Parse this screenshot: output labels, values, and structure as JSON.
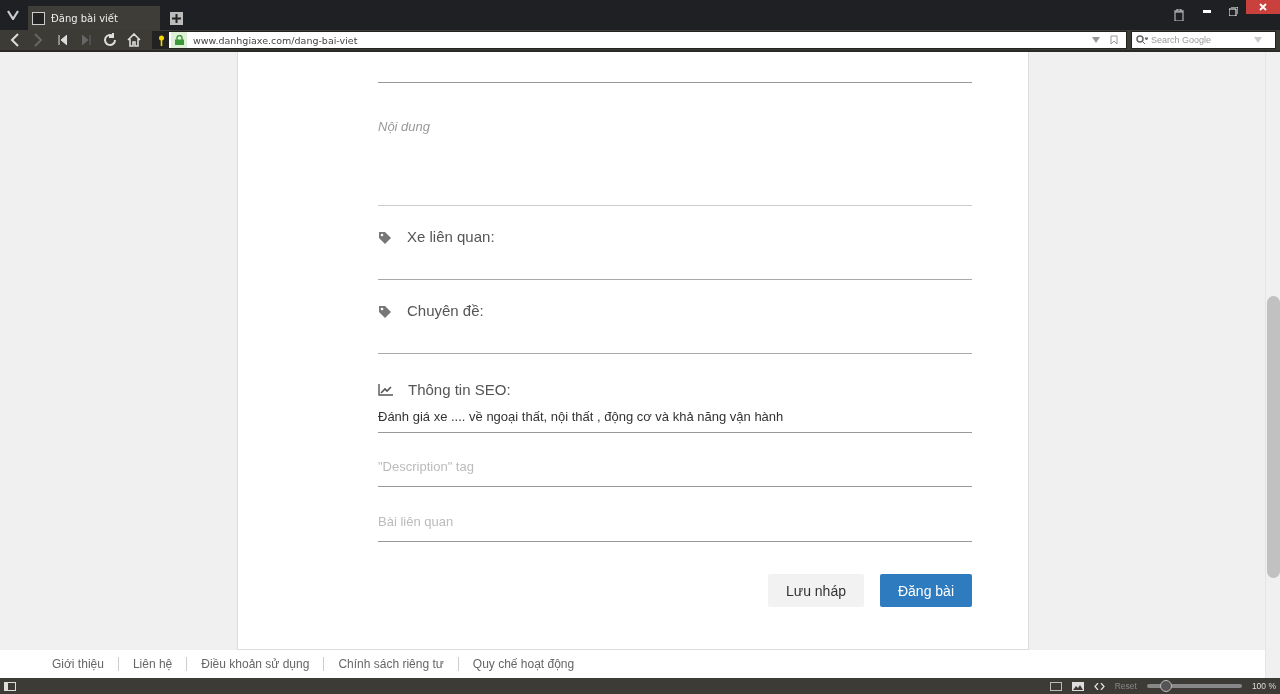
{
  "browser": {
    "tab": {
      "title": "Đăng bài viết",
      "selected": true
    },
    "url": "www.danhgiaxe.com/dang-bai-viet",
    "search": {
      "placeholder": "Search Google"
    }
  },
  "form": {
    "content": {
      "placeholder": "Nội dung"
    },
    "tag_fields": [
      {
        "label": "Xe liên quan:"
      },
      {
        "label": "Chuyên đề:"
      }
    ],
    "seo": {
      "label": "Thông tin SEO:",
      "title_value": "Đánh giá xe .... về ngoại thất, nội thất , động cơ và khả năng vận hành",
      "description": {
        "placeholder": "\"Description\" tag"
      },
      "related": {
        "placeholder": "Bài liên quan"
      }
    },
    "buttons": [
      {
        "label": "Lưu nháp",
        "kind": "secondary"
      },
      {
        "label": "Đăng bài",
        "kind": "primary"
      }
    ]
  },
  "footer_links": [
    "Giới thiệu",
    "Liên hệ",
    "Điều khoản sử dụng",
    "Chính sách riêng tư",
    "Quy chế hoạt động"
  ],
  "status_bar": {
    "reset": "Reset",
    "zoom": {
      "level": 0.2,
      "reading": "100 %"
    }
  }
}
